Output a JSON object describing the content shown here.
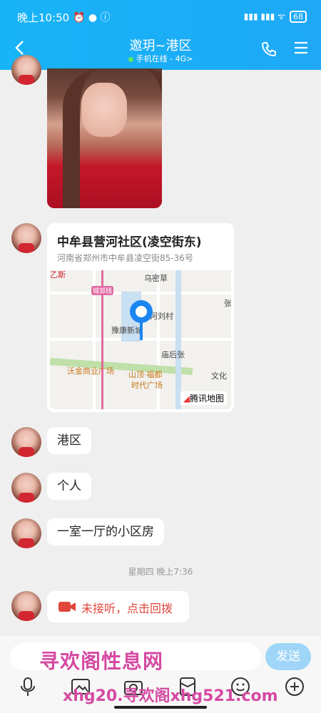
{
  "status_bar": {
    "time": "晚上10:50",
    "battery": "68"
  },
  "header": {
    "title": "邀玥~港区",
    "subtitle": "手机在线 - 4G",
    "subtitle_chevron": ">"
  },
  "location": {
    "title": "中牟县营河社区(凌空街东)",
    "address": "河南省郑州市中牟县凌空街85-36号",
    "map_labels": [
      "乌密草",
      "城郊线",
      "河刘村",
      "豫康新城",
      "张",
      "庙后张",
      "沃金商业广场",
      "山顶·福都",
      "时代广场",
      "文化",
      "乙斯"
    ],
    "map_brand": "腾讯地图"
  },
  "messages": [
    "港区",
    "个人",
    "一室一厅的小区房"
  ],
  "timestamp": "星期四 晚上7:36",
  "missed_call": "未接听，点击回拨",
  "composer": {
    "send_label": "发送"
  },
  "watermark": {
    "line1": "寻欢阁性息网",
    "line2": "xhg20.寻欢阁xhg521.com"
  }
}
